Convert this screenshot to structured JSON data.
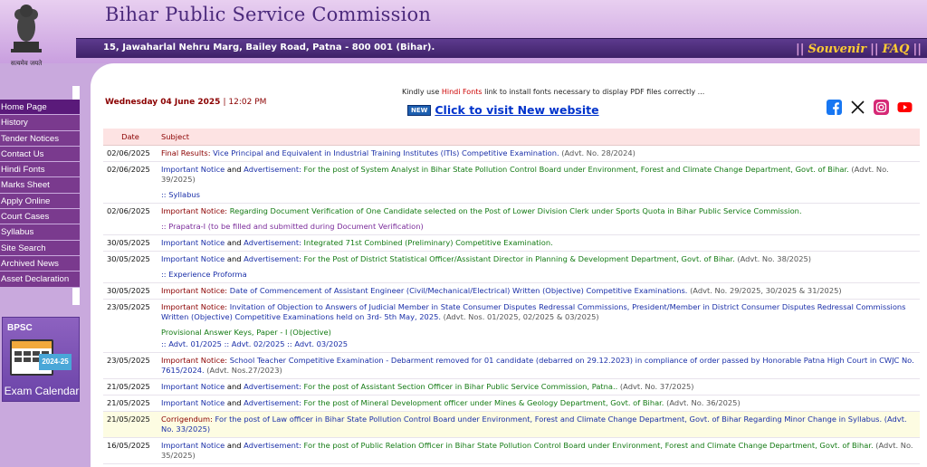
{
  "header": {
    "title": "Bihar Public Service Commission",
    "address": "15, Jawaharlal Nehru Marg, Bailey Road, Patna - 800 001 (Bihar).",
    "links": [
      "Souvenir",
      "FAQ"
    ],
    "emblem_motto": "सत्यमेव जयते"
  },
  "sidebar": {
    "items": [
      "Home Page",
      "History",
      "Tender Notices",
      "Contact Us",
      "Hindi Fonts",
      "Marks Sheet",
      "Apply Online",
      "Court Cases",
      "Syllabus",
      "Site Search",
      "Archived News",
      "Asset Declaration"
    ],
    "exam_calendar": {
      "brand": "BPSC",
      "year": "2024-25",
      "label": "Exam Calendar"
    }
  },
  "main": {
    "date": "Wednesday 04 June 2025",
    "time": "12:02 PM",
    "fonts_note_pre": "Kindly use ",
    "fonts_note_link": "Hindi Fonts",
    "fonts_note_post": " link to install fonts necessary to display PDF files correctly ...",
    "new_badge": "NEW",
    "new_site_link": "Click to visit New website",
    "social": [
      "facebook-icon",
      "x-icon",
      "instagram-icon",
      "youtube-icon"
    ],
    "table": {
      "headers": [
        "Date",
        "Subject"
      ],
      "rows": [
        {
          "date": "02/06/2025",
          "p1": "Final Results:",
          "p2": " Vice Principal and Equivalent in Industrial Training Institutes (ITIs) Competitive Examination.",
          "p3": " (Advt. No. 28/2024)"
        },
        {
          "date": "02/06/2025",
          "p1": "Important Notice",
          "mid": " and ",
          "p2": "Advertisement:",
          "p3": " For the post of System Analyst in Bihar State Pollution Control Board under Environment, Forest and Climate Change Department, Govt. of Bihar.",
          "p4": " (Advt. No. 39/2025)",
          "sub": ":: Syllabus"
        },
        {
          "date": "02/06/2025",
          "p1": "Important Notice:",
          "p2": " Regarding Document Verification of One Candidate selected on the Post of Lower Division Clerk under Sports Quota in Bihar Public Service Commission.",
          "sub": ":: Prapatra-I (to be filled and submitted during Document Verification)"
        },
        {
          "date": "30/05/2025",
          "p1": "Important Notice",
          "mid": " and ",
          "p2": "Advertisement:",
          "p3": " Integrated 71st Combined (Preliminary) Competitive Examination."
        },
        {
          "date": "30/05/2025",
          "p1": "Important Notice",
          "mid": " and ",
          "p2": "Advertisement:",
          "p3": " For the Post of District Statistical Officer/Assistant Director in Planning & Development Department, Govt. of Bihar.",
          "p4": " (Advt. No. 38/2025)",
          "sub": ":: Experience Proforma"
        },
        {
          "date": "30/05/2025",
          "p1": "Important Notice:",
          "p2": " Date of Commencement of Assistant Engineer (Civil/Mechanical/Electrical) Written (Objective) Competitive Examinations.",
          "p3": " (Advt. No. 29/2025, 30/2025 & 31/2025)"
        },
        {
          "date": "23/05/2025",
          "p1": "Important Notice:",
          "p2": " Invitation of Objection to Answers of Judicial Member in State Consumer Disputes Redressal Commissions, President/Member in District Consumer Disputes Redressal Commissions Written (Objective) Competitive Examinations held on 3rd- 5th May, 2025.",
          "p3": " (Advt. Nos. 01/2025, 02/2025 & 03/2025)",
          "sub": "Provisional Answer Keys, Paper - I (Objective)",
          "sub2": ":: Advt. 01/2025 :: Advt. 02/2025 :: Advt. 03/2025"
        },
        {
          "date": "23/05/2025",
          "p1": "Important Notice:",
          "p2": " School Teacher Competitive Examination - Debarment removed for 01 candidate (debarred on 29.12.2023) in compliance of order passed by Honorable Patna High Court in CWJC No. 7615/2024.",
          "p3": " (Advt. Nos.27/2023)"
        },
        {
          "date": "21/05/2025",
          "p1": "Important Notice",
          "mid": " and ",
          "p2": "Advertisement:",
          "p3": " For the post of Assistant Section Officer in Bihar Public Service Commission, Patna..",
          "p4": " (Advt. No. 37/2025)"
        },
        {
          "date": "21/05/2025",
          "p1": "Important Notice",
          "mid": " and ",
          "p2": "Advertisement:",
          "p3": " For the post of Mineral Development officer under Mines & Geology Department, Govt. of Bihar.",
          "p4": " (Advt. No. 36/2025)"
        },
        {
          "date": "21/05/2025",
          "p1": "Corrigendum:",
          "p2": " For the post of Law officer in Bihar State Pollution Control Board under Environment, Forest and Climate Change Department, Govt. of Bihar Regarding Minor Change in Syllabus.",
          "p3": " (Advt. No. 33/2025)"
        },
        {
          "date": "16/05/2025",
          "p1": "Important Notice",
          "mid": " and ",
          "p2": "Advertisement:",
          "p3": " For the post of Public Relation Officer in Bihar State Pollution Control Board under Environment, Forest and Climate Change Department, Govt. of Bihar.",
          "p4": " (Advt. No. 35/2025)"
        }
      ]
    }
  }
}
